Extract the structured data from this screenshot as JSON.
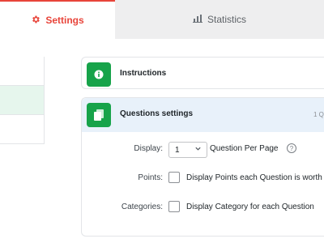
{
  "tabs": {
    "settings": {
      "label": "Settings",
      "icon": "gear-icon",
      "color": "#e8443a"
    },
    "statistics": {
      "label": "Statistics",
      "icon": "bar-chart-icon"
    }
  },
  "sections": {
    "instructions": {
      "title": "Instructions",
      "icon": "info-icon"
    },
    "questions": {
      "title": "Questions settings",
      "icon": "document-icon",
      "count": "1 Qu",
      "display": {
        "label": "Display:",
        "value": "1",
        "suffix": "Question Per Page",
        "help": "?"
      },
      "points": {
        "label": "Points:",
        "checked": false,
        "text": "Display Points each Question is worth"
      },
      "categories": {
        "label": "Categories:",
        "checked": false,
        "text": "Display Category for each Question"
      }
    }
  },
  "colors": {
    "accent": "#e8443a",
    "icon_green": "#17a34a",
    "header_blue": "#e8f1fa",
    "active_row": "#e6f6ed"
  }
}
